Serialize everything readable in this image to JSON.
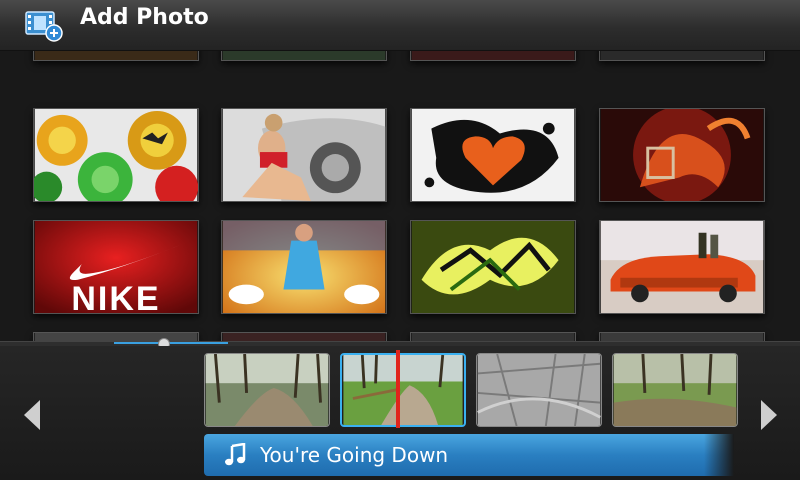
{
  "header": {
    "title": "Add Photo",
    "icon": "film-add-icon"
  },
  "photo_grid": {
    "tiles": [
      {
        "name": "photo-bottle-caps",
        "row": 1,
        "col": 1
      },
      {
        "name": "photo-car-woman",
        "row": 1,
        "col": 2
      },
      {
        "name": "photo-heart-splatter",
        "row": 1,
        "col": 3
      },
      {
        "name": "photo-dragon",
        "row": 1,
        "col": 4
      },
      {
        "name": "photo-nike",
        "row": 2,
        "col": 1,
        "overlay_text": "NIKE"
      },
      {
        "name": "photo-dancer",
        "row": 2,
        "col": 2
      },
      {
        "name": "photo-graffiti",
        "row": 2,
        "col": 3
      },
      {
        "name": "photo-muscle-car",
        "row": 2,
        "col": 4
      }
    ]
  },
  "timeline": {
    "thumbnails": [
      "forest-path",
      "meadow-path",
      "textured-stone",
      "forest-clearing"
    ],
    "selected_index": 1
  },
  "music": {
    "title": "You're Going Down",
    "icon": "music-note-icon"
  },
  "nav": {
    "left": "chevron-left-icon",
    "right": "chevron-right-icon"
  },
  "colors": {
    "accent": "#3aa0e0",
    "playhead": "#e0241c",
    "music_bar": "#2a7fc1"
  }
}
